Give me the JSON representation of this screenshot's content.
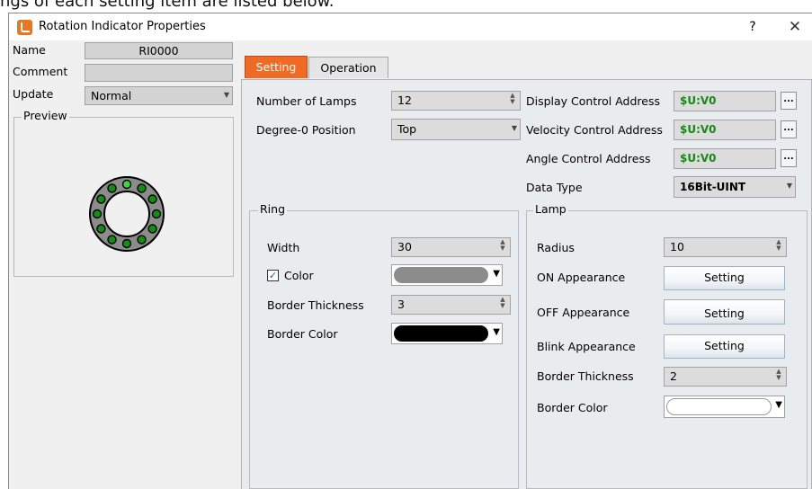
{
  "top_strip_text": "ngs of each setting item are listed below.",
  "window": {
    "title": "Rotation Indicator Properties",
    "help_label": "?",
    "close_label": "✕"
  },
  "left": {
    "name_label": "Name",
    "name_value": "RI0000",
    "comment_label": "Comment",
    "comment_value": "",
    "update_label": "Update",
    "update_value": "Normal",
    "preview_label": "Preview"
  },
  "tabs": [
    {
      "label": "Setting",
      "active": true
    },
    {
      "label": "Operation",
      "active": false
    }
  ],
  "setting": {
    "number_of_lamps_label": "Number of Lamps",
    "number_of_lamps_value": "12",
    "degree0_label": "Degree-0 Position",
    "degree0_value": "Top",
    "display_ctrl_label": "Display Control Address",
    "display_ctrl_value": "$U:V0",
    "velocity_ctrl_label": "Velocity Control Address",
    "velocity_ctrl_value": "$U:V0",
    "angle_ctrl_label": "Angle Control Address",
    "angle_ctrl_value": "$U:V0",
    "ellipsis_label": "...",
    "data_type_label": "Data Type",
    "data_type_value": "16Bit-UINT"
  },
  "ring": {
    "group_label": "Ring",
    "width_label": "Width",
    "width_value": "30",
    "color_label": "Color",
    "color_checked": true,
    "color_swatch": "#8c8c8c",
    "border_thickness_label": "Border Thickness",
    "border_thickness_value": "3",
    "border_color_label": "Border Color",
    "border_color_swatch": "#000000"
  },
  "lamp": {
    "group_label": "Lamp",
    "radius_label": "Radius",
    "radius_value": "10",
    "on_label": "ON Appearance",
    "off_label": "OFF Appearance",
    "blink_label": "Blink Appearance",
    "setting_btn_label": "Setting",
    "border_thickness_label": "Border Thickness",
    "border_thickness_value": "2",
    "border_color_label": "Border Color",
    "border_color_swatch": "#ffffff"
  },
  "colors": {
    "tab_active": "#ef6a24",
    "address_text": "#168a16",
    "lamp_on": "#3fd33f",
    "lamp_off": "#109010",
    "ring": "#8c8c8c"
  }
}
